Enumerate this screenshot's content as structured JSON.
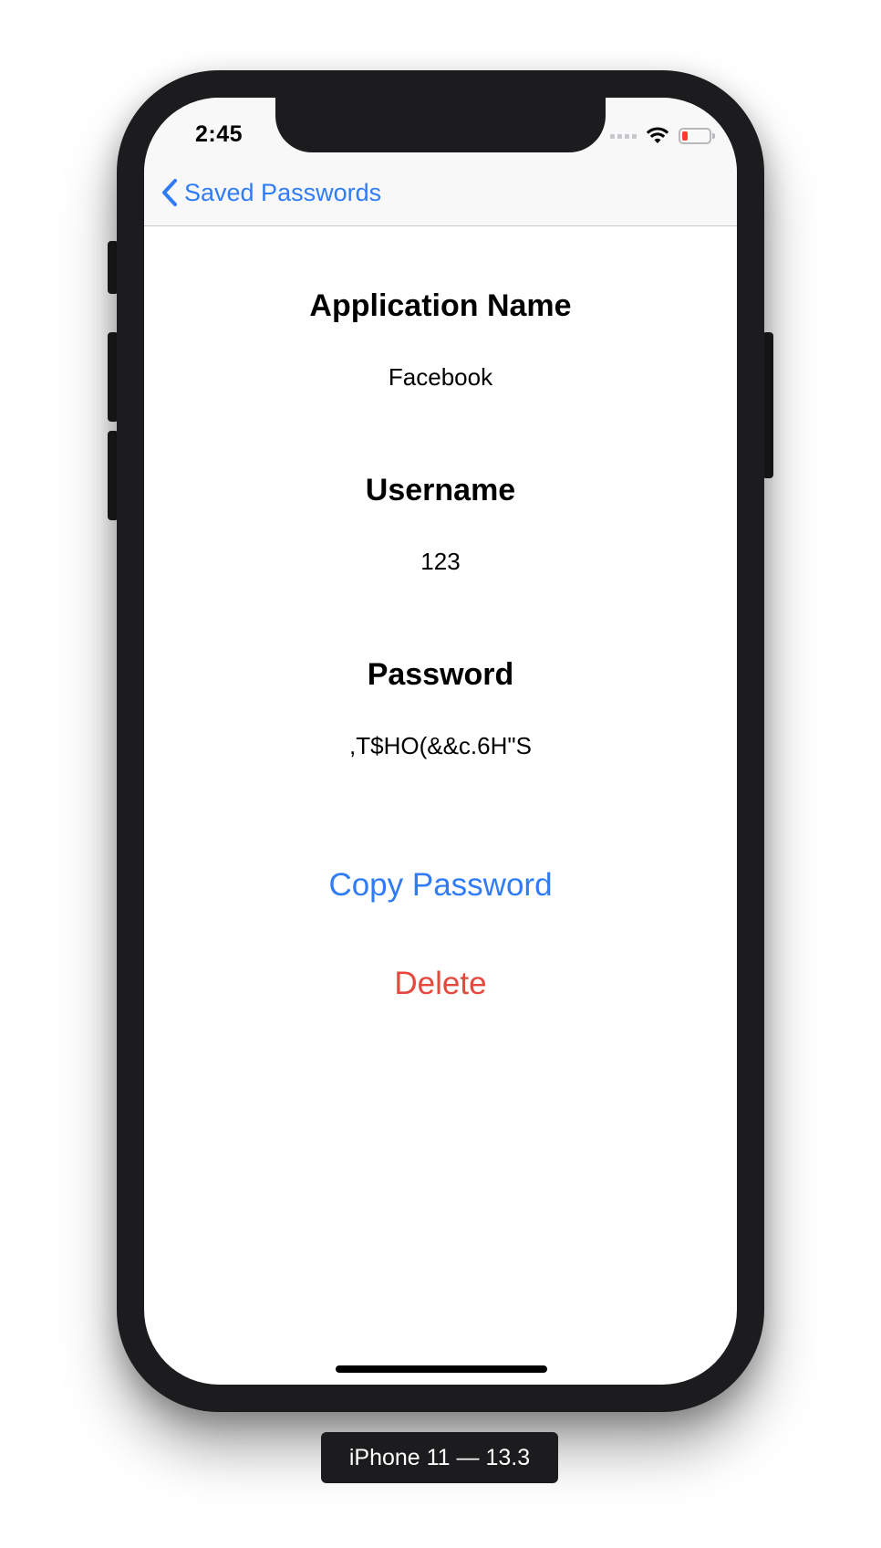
{
  "status_bar": {
    "time": "2:45",
    "battery_color": "#ff3b30"
  },
  "nav": {
    "back_label": "Saved Passwords",
    "accent_color": "#2f7cf6"
  },
  "detail": {
    "app_name_heading": "Application Name",
    "app_name_value": "Facebook",
    "username_heading": "Username",
    "username_value": "123",
    "password_heading": "Password",
    "password_value": ",T$HO(&&c.6H\"S"
  },
  "actions": {
    "copy_label": "Copy Password",
    "delete_label": "Delete",
    "delete_color": "#e5483d"
  },
  "device": {
    "label": "iPhone 11 — 13.3"
  }
}
